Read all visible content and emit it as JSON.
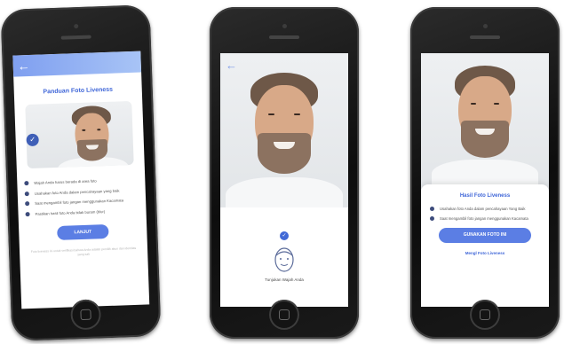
{
  "screens": {
    "guide": {
      "title": "Panduan Foto Liveness",
      "tips": [
        "Wajah Anda harus berada di area foto",
        "Usahakan foto Anda dalam pencahayaan yang baik",
        "Saat mengambil foto jangan menggunakan Kacamata",
        "Pastikan hasil foto Anda tidak buram (blur)"
      ],
      "button": "LANJUT",
      "footnote": "Foto liveness ini untuk verifikasi bahwa Anda adalah pemilik akun dan identitas yang sah"
    },
    "capture": {
      "instruction": "Tunjukan Wajah Anda"
    },
    "result": {
      "title": "Hasil Foto Liveness",
      "tips": [
        "Usahakan foto Anda dalam pencahayaan Yang Baik",
        "Saat mengambil foto jangan menggunakan Kacamata"
      ],
      "button": "GUNAKAN FOTO INI",
      "retake": "Mengl Foto Liveness"
    }
  },
  "icons": {
    "back": "←",
    "check": "✓"
  },
  "colors": {
    "accent": "#3f66d8",
    "button": "#5b7ee4",
    "header_gradient_start": "#7f9ff0",
    "header_gradient_end": "#a8c4f6",
    "bullet": "#3d4c7c"
  }
}
